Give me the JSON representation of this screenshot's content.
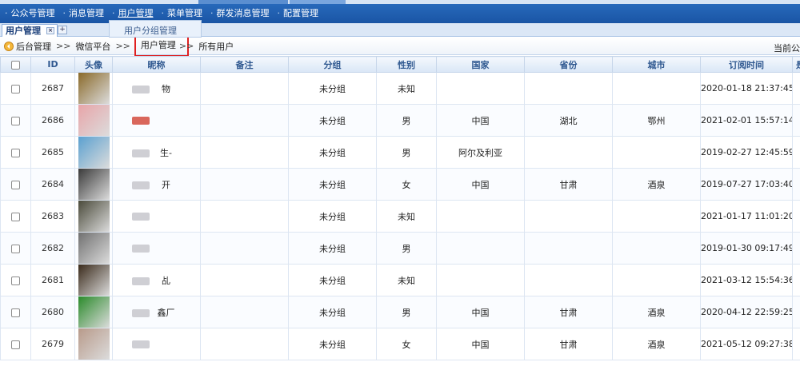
{
  "topnav": {
    "items": [
      {
        "label": "公众号管理"
      },
      {
        "label": "消息管理"
      },
      {
        "label": "用户管理"
      },
      {
        "label": "菜单管理"
      },
      {
        "label": "群发消息管理"
      },
      {
        "label": "配置管理"
      }
    ],
    "active_index": 2
  },
  "tabs": {
    "current": "用户管理",
    "close_icon": "×",
    "add_icon": "+"
  },
  "dropdown": {
    "item": "用户分组管理"
  },
  "breadcrumb": {
    "items": [
      "后台管理",
      "微信平台",
      "用户管理",
      "所有用户"
    ],
    "separator": ">>",
    "right": "当前公"
  },
  "table": {
    "headers": [
      "ID",
      "头像",
      "昵称",
      "备注",
      "分组",
      "性别",
      "国家",
      "省份",
      "城市",
      "订阅时间",
      "是"
    ],
    "rows": [
      {
        "id": "2687",
        "nick": "物",
        "remark": "",
        "group": "未分组",
        "gender": "未知",
        "country": "",
        "province": "",
        "city": "",
        "time": "2020-01-18 21:37:45"
      },
      {
        "id": "2686",
        "nick": "",
        "remark": "",
        "group": "未分组",
        "gender": "男",
        "country": "中国",
        "province": "湖北",
        "city": "鄂州",
        "time": "2021-02-01 15:57:14"
      },
      {
        "id": "2685",
        "nick": "生-",
        "remark": "",
        "group": "未分组",
        "gender": "男",
        "country": "阿尔及利亚",
        "province": "",
        "city": "",
        "time": "2019-02-27 12:45:59"
      },
      {
        "id": "2684",
        "nick": "开",
        "remark": "",
        "group": "未分组",
        "gender": "女",
        "country": "中国",
        "province": "甘肃",
        "city": "酒泉",
        "time": "2019-07-27 17:03:40"
      },
      {
        "id": "2683",
        "nick": "",
        "remark": "",
        "group": "未分组",
        "gender": "未知",
        "country": "",
        "province": "",
        "city": "",
        "time": "2021-01-17 11:01:20"
      },
      {
        "id": "2682",
        "nick": "",
        "remark": "",
        "group": "未分组",
        "gender": "男",
        "country": "",
        "province": "",
        "city": "",
        "time": "2019-01-30 09:17:49"
      },
      {
        "id": "2681",
        "nick": "乩",
        "remark": "",
        "group": "未分组",
        "gender": "未知",
        "country": "",
        "province": "",
        "city": "",
        "time": "2021-03-12 15:54:36"
      },
      {
        "id": "2680",
        "nick": "鑫厂",
        "remark": "",
        "group": "未分组",
        "gender": "男",
        "country": "中国",
        "province": "甘肃",
        "city": "酒泉",
        "time": "2020-04-12 22:59:25"
      },
      {
        "id": "2679",
        "nick": "",
        "remark": "",
        "group": "未分组",
        "gender": "女",
        "country": "中国",
        "province": "甘肃",
        "city": "酒泉",
        "time": "2021-05-12 09:27:38"
      }
    ]
  },
  "colors": {
    "nav_bg": "#1a55a5",
    "header_text": "#2f5890",
    "highlight_border": "#e02020"
  },
  "avatars": [
    "#8a6a2a",
    "#e8a4a8",
    "#5aa0d0",
    "#3a3a3a",
    "#4a4a3a",
    "#707070",
    "#3a2a1a",
    "#2a8a2a",
    "#b89a8a"
  ]
}
